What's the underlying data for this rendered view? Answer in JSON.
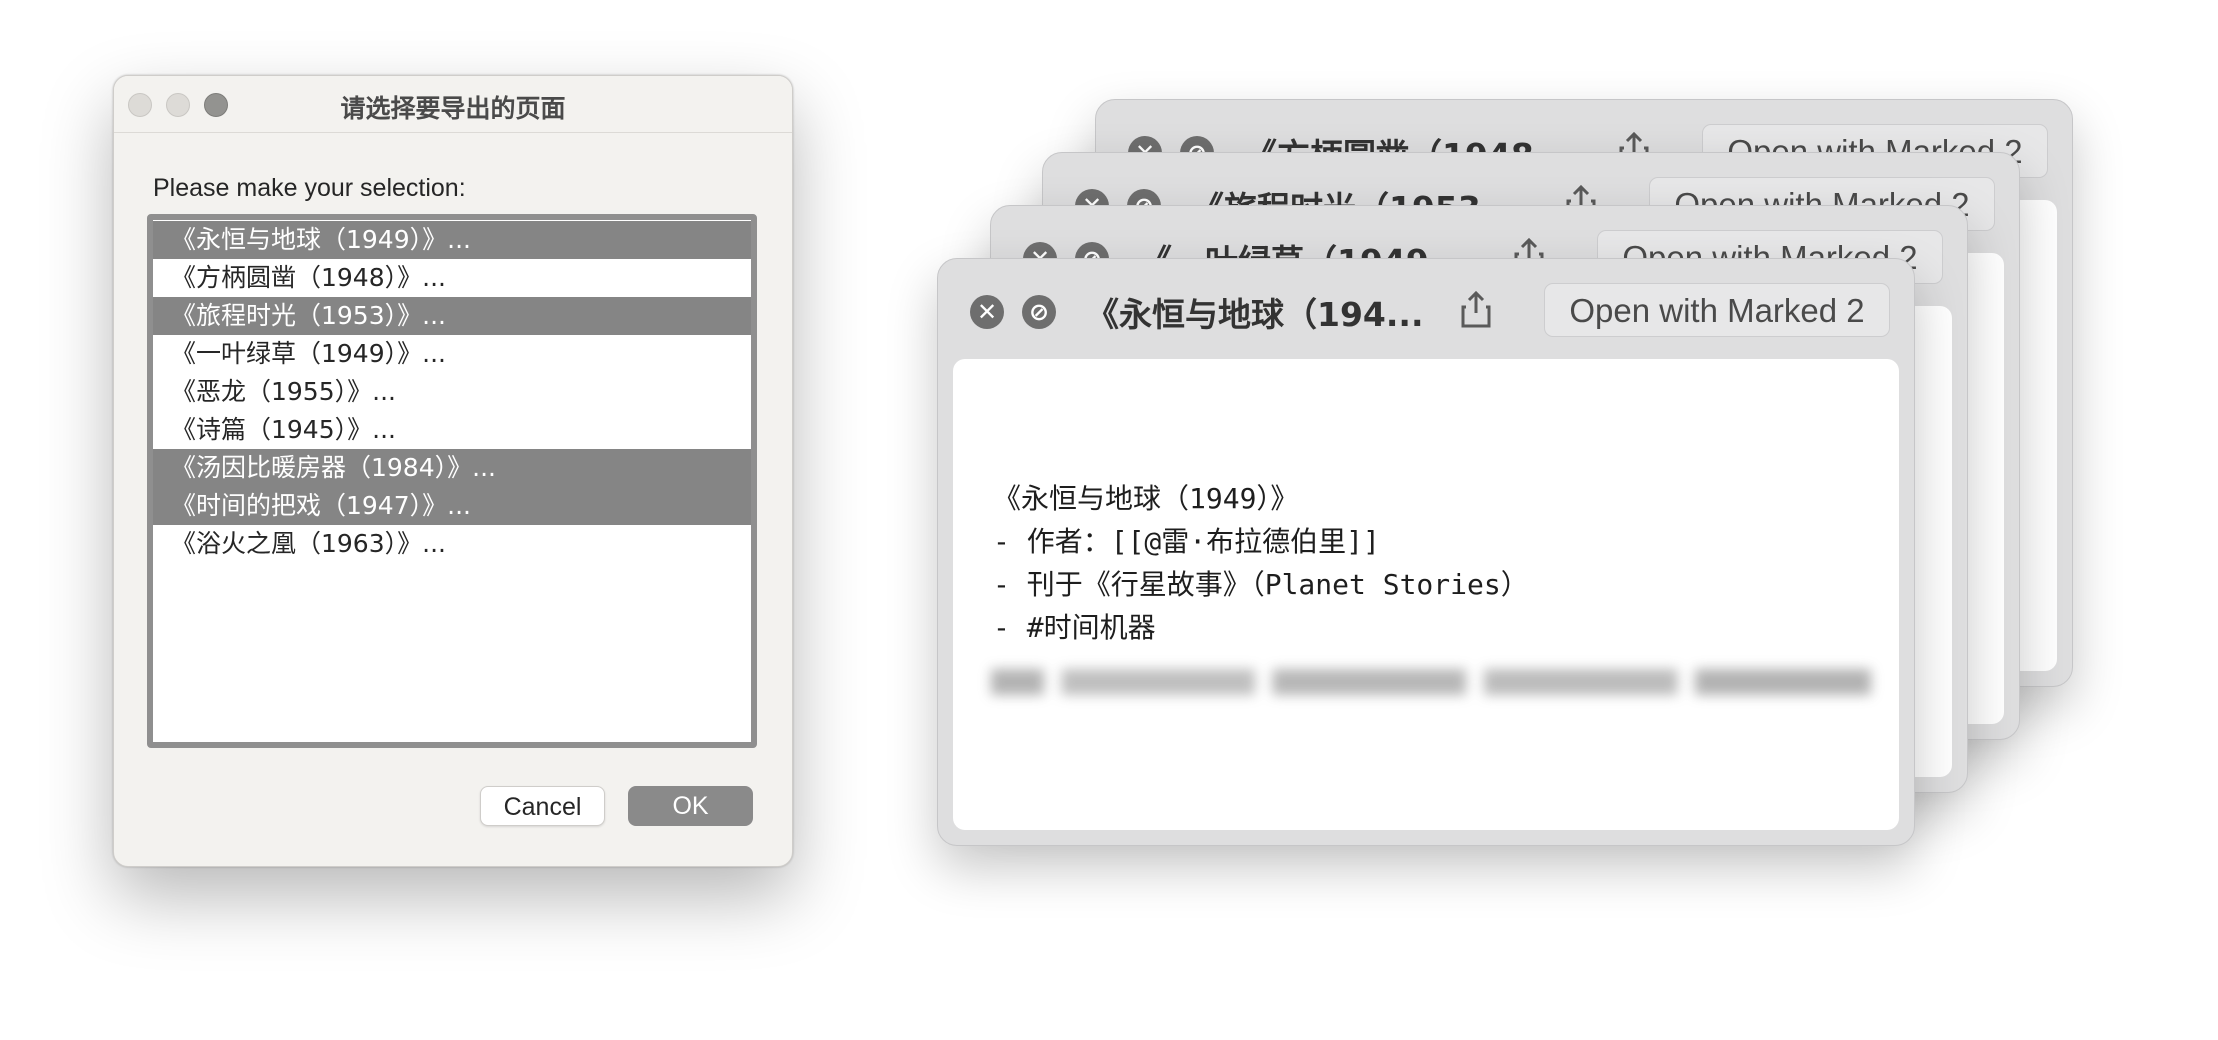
{
  "dialog": {
    "title": "请选择要导出的页面",
    "prompt": "Please make your selection:",
    "items": [
      {
        "label": "《永恒与地球（1949）》...",
        "selected": true
      },
      {
        "label": "《方柄圆凿（1948）》...",
        "selected": false
      },
      {
        "label": "《旅程时光（1953）》...",
        "selected": true
      },
      {
        "label": "《一叶绿草（1949）》...",
        "selected": false
      },
      {
        "label": "《恶龙（1955）》...",
        "selected": false
      },
      {
        "label": "《诗篇（1945）》...",
        "selected": false
      },
      {
        "label": "《汤因比暖房器（1984）》...",
        "selected": true
      },
      {
        "label": "《时间的把戏（1947）》...",
        "selected": true
      },
      {
        "label": "《浴火之凰（1963）》...",
        "selected": false
      }
    ],
    "cancel_label": "Cancel",
    "ok_label": "OK"
  },
  "windows": [
    {
      "title": "《永恒与地球（194...",
      "open_label": "Open with Marked 2"
    },
    {
      "title": "《一叶绿草（1949",
      "open_label": "Open with Marked 2"
    },
    {
      "title": "《旅程时光（1953",
      "open_label": "Open with Marked 2"
    },
    {
      "title": "《方柄圆凿（1948",
      "open_label": "Open with Marked 2"
    }
  ],
  "note": {
    "lines": [
      "《永恒与地球（1949）》",
      "- 作者：[[@雷·布拉德伯里]]",
      "- 刊于《行星故事》（Planet Stories）",
      "- #时间机器"
    ]
  },
  "colors": {
    "selection": "#858585",
    "dialog_bg": "#f3f2ef",
    "window_bg": "#dededf"
  }
}
